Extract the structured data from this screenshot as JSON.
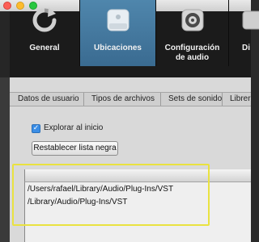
{
  "toolbar": {
    "items": [
      {
        "label": "General",
        "icon": "refresh-icon"
      },
      {
        "label": "Ubicaciones",
        "icon": "drive-icon"
      },
      {
        "label": "Configuración de audio",
        "icon": "speaker-icon"
      },
      {
        "label": "Di",
        "icon": "device-icon"
      }
    ]
  },
  "tabs": [
    {
      "label": "Datos de usuario"
    },
    {
      "label": "Tipos de archivos"
    },
    {
      "label": "Sets de sonido"
    },
    {
      "label": "Librería"
    }
  ],
  "options": {
    "scan_on_start_label": "Explorar al inicio",
    "scan_on_start_checked": true,
    "reset_blacklist_label": "Restablecer lista negra"
  },
  "plugin_paths": [
    "/Users/rafael/Library/Audio/Plug-Ins/VST",
    "/Library/Audio/Plug-Ins/VST"
  ],
  "colors": {
    "active_tab": "#3f75a0",
    "highlight_box": "#e9e240",
    "checkbox": "#3b8ee6"
  }
}
